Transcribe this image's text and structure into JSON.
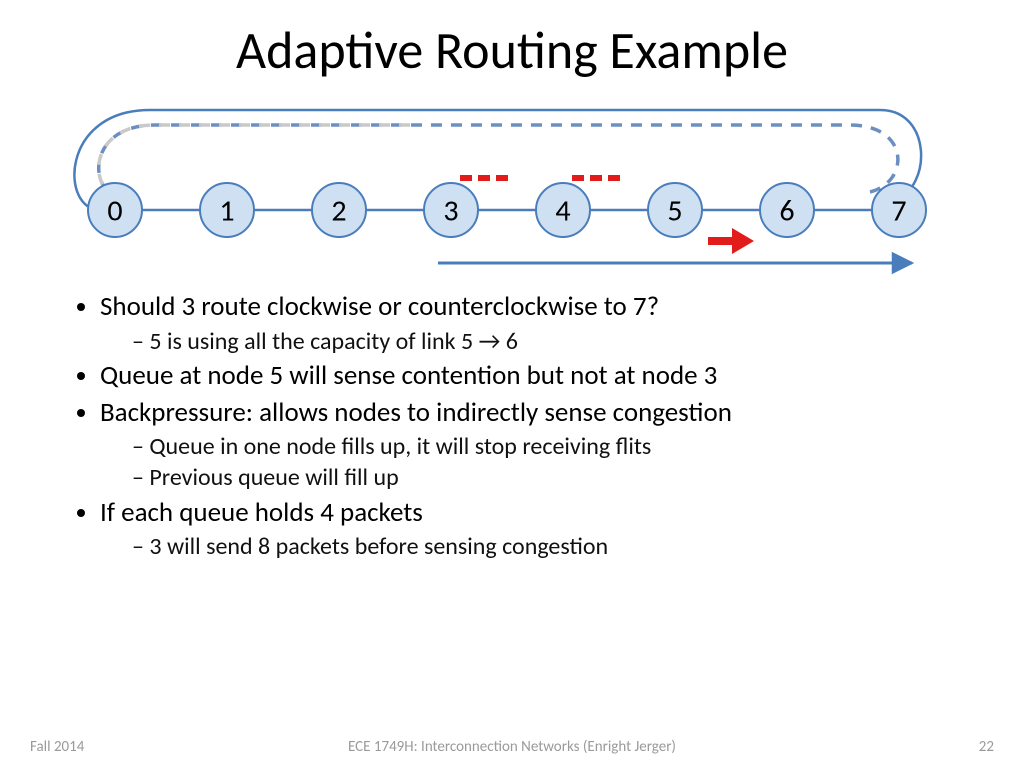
{
  "title": "Adaptive Routing Example",
  "nodes": [
    "0",
    "1",
    "2",
    "3",
    "4",
    "5",
    "6",
    "7"
  ],
  "bullets": {
    "b1": "Should 3 route clockwise or counterclockwise to 7?",
    "b1_1": "5 is using all the capacity of link 5 → 6",
    "b2": "Queue at node 5 will sense contention but not at node 3",
    "b3": "Backpressure: allows nodes to indirectly sense congestion",
    "b3_1": "Queue in one node fills up, it will stop receiving flits",
    "b3_2": "Previous queue will fill up",
    "b4": "If each queue holds 4 packets",
    "b4_1": "3 will send 8 packets before sensing congestion"
  },
  "footer": {
    "left": "Fall 2014",
    "center": "ECE 1749H: Interconnection Networks (Enright Jerger)",
    "right": "22"
  },
  "colors": {
    "node_fill": "#CFE0F2",
    "node_stroke": "#4A7DBB",
    "link": "#4A7DBB",
    "accent": "#E21B1B"
  }
}
